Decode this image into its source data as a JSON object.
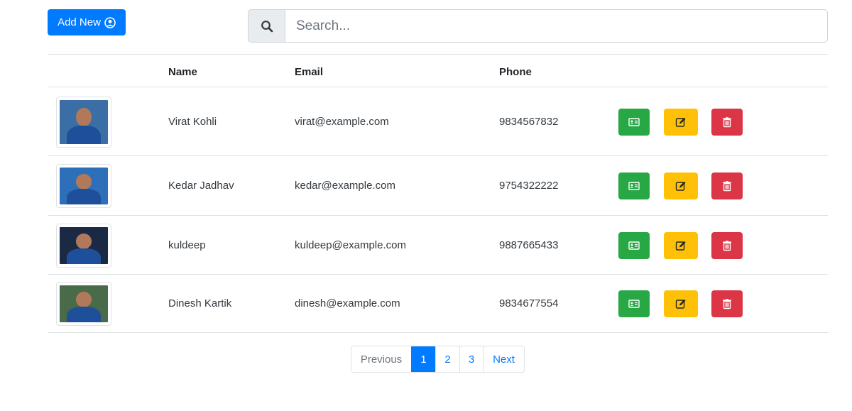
{
  "toolbar": {
    "add_label": "Add New"
  },
  "search": {
    "placeholder": "Search...",
    "value": ""
  },
  "table": {
    "columns": {
      "name": "Name",
      "email": "Email",
      "phone": "Phone"
    },
    "rows": [
      {
        "name": "Virat Kohli",
        "email": "virat@example.com",
        "phone": "9834567832",
        "photo_bg": "#3a6ea5"
      },
      {
        "name": "Kedar Jadhav",
        "email": "kedar@example.com",
        "phone": "9754322222",
        "photo_bg": "#2d6fb8"
      },
      {
        "name": "kuldeep",
        "email": "kuldeep@example.com",
        "phone": "9887665433",
        "photo_bg": "#1b2a44"
      },
      {
        "name": "Dinesh Kartik",
        "email": "dinesh@example.com",
        "phone": "9834677554",
        "photo_bg": "#4a6b4a"
      }
    ],
    "actions": [
      "id-card-icon",
      "edit-icon",
      "trash-icon"
    ]
  },
  "pagination": {
    "previous": "Previous",
    "pages": [
      "1",
      "2",
      "3"
    ],
    "active": "1",
    "next": "Next"
  },
  "colors": {
    "primary": "#007bff",
    "success": "#28a745",
    "warning": "#ffc107",
    "danger": "#dc3545"
  }
}
